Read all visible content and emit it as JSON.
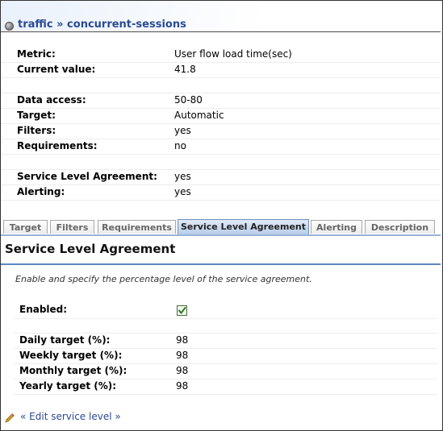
{
  "title": {
    "text": "traffic » concurrent-sessions",
    "icon": "bullet-icon"
  },
  "properties": [
    {
      "label": "Metric:",
      "value": "User flow load time(sec)"
    },
    {
      "label": "Current value:",
      "value": "41.8"
    },
    {
      "label": "Data access:",
      "value": "50-80"
    },
    {
      "label": "Target:",
      "value": "Automatic"
    },
    {
      "label": "Filters:",
      "value": "yes"
    },
    {
      "label": "Requirements:",
      "value": "no"
    },
    {
      "label": "Service Level Agreement:",
      "value": "yes"
    },
    {
      "label": "Alerting:",
      "value": "yes"
    }
  ],
  "tabs": [
    {
      "label": "Target",
      "active": false
    },
    {
      "label": "Filters",
      "active": false
    },
    {
      "label": "Requirements",
      "active": false
    },
    {
      "label": "Service Level Agreement",
      "active": true
    },
    {
      "label": "Alerting",
      "active": false
    },
    {
      "label": "Description",
      "active": false
    }
  ],
  "sla": {
    "heading": "Service Level Agreement",
    "description": "Enable and specify the percentage level of the service agreement.",
    "enabled_label": "Enabled:",
    "enabled": true,
    "targets": [
      {
        "label": "Daily target (%):",
        "value": "98"
      },
      {
        "label": "Weekly target (%):",
        "value": "98"
      },
      {
        "label": "Monthly target (%):",
        "value": "98"
      },
      {
        "label": "Yearly target (%):",
        "value": "98"
      }
    ]
  },
  "edit_link": {
    "text": "« Edit service level »",
    "icon": "pencil-icon"
  },
  "colors": {
    "link": "#2a4a93",
    "tab_active": "#b9cde8",
    "rule": "#5d87c0"
  }
}
